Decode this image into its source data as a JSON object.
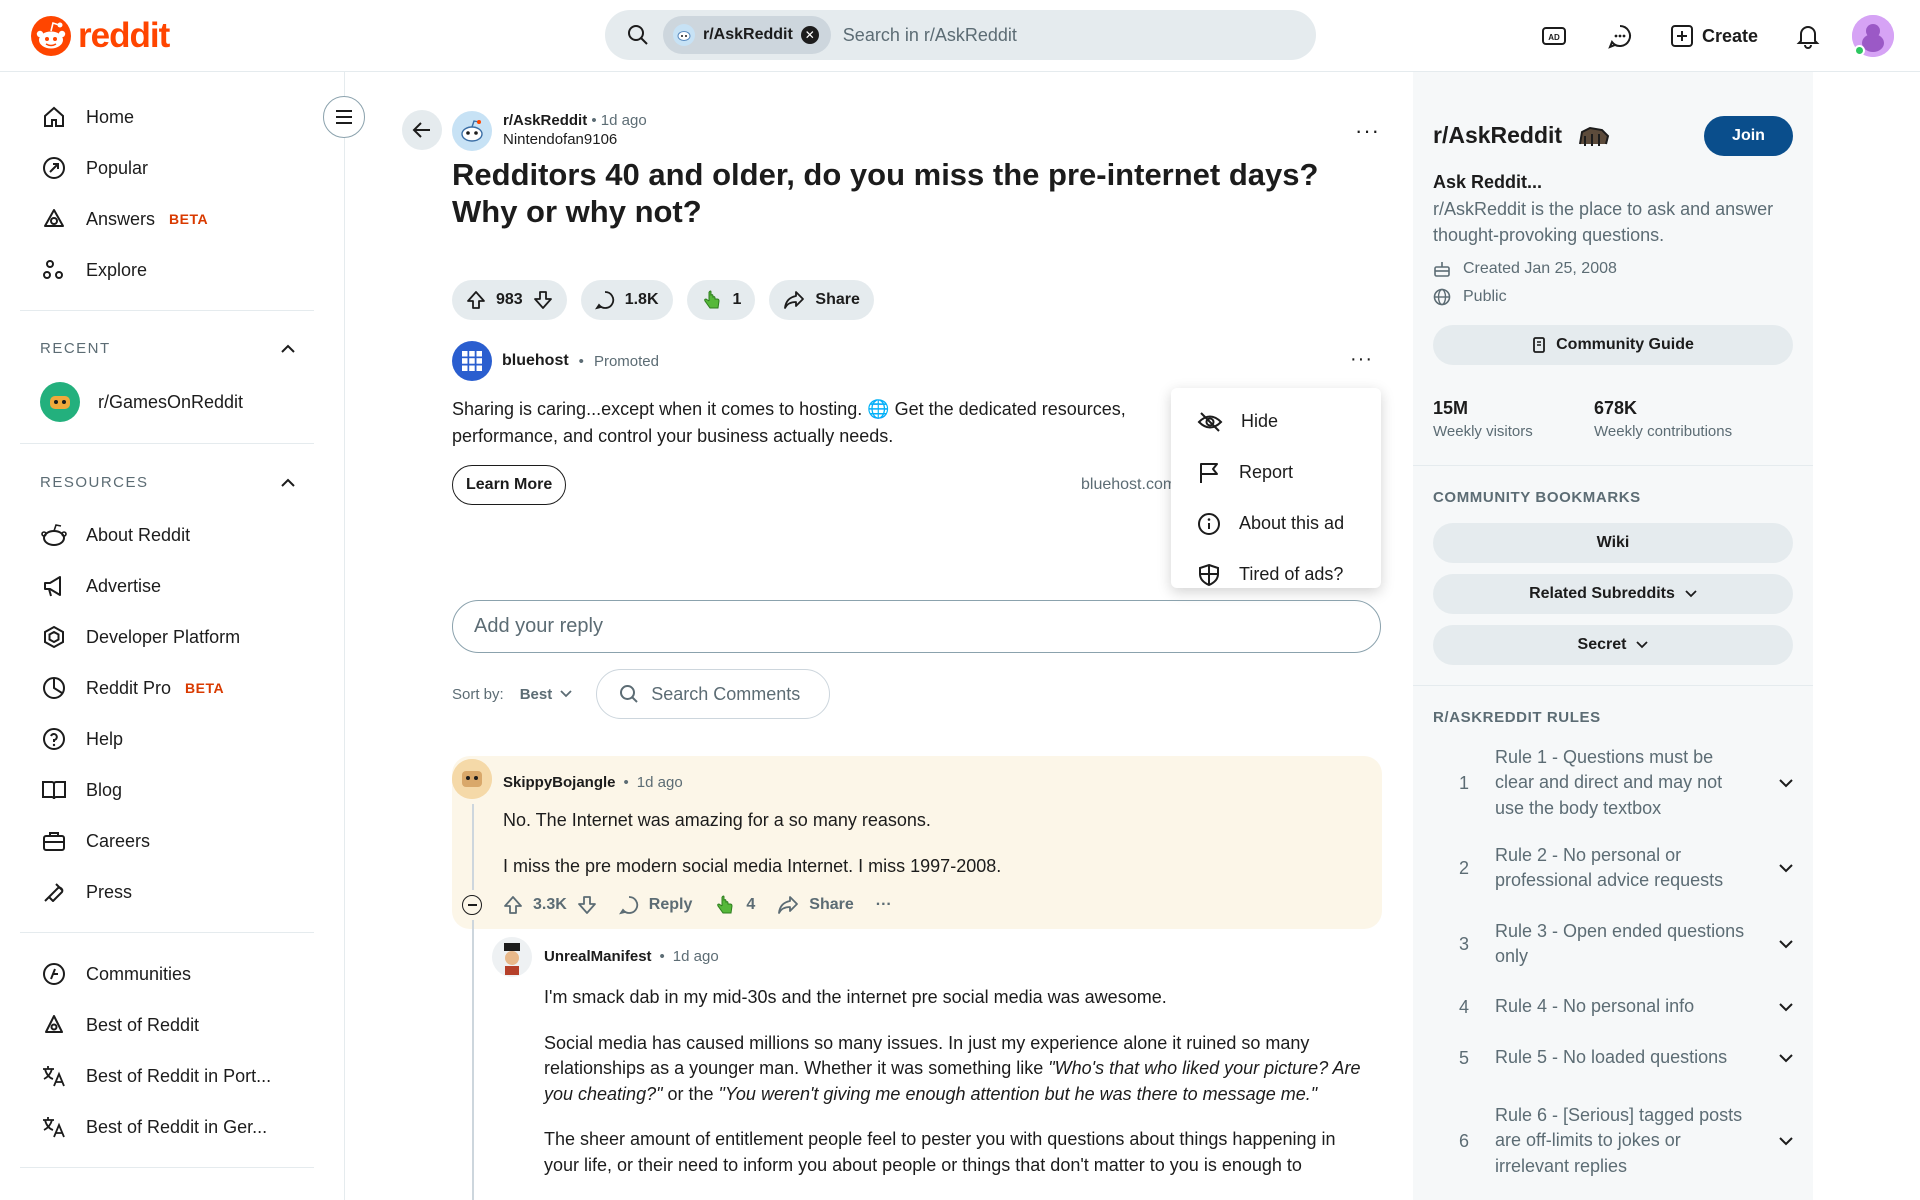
{
  "header": {
    "logo_text": "reddit",
    "search_chip": "r/AskReddit",
    "search_placeholder": "Search in r/AskReddit",
    "create_label": "Create",
    "brand_color": "#ff4500"
  },
  "sidebar": {
    "nav": [
      {
        "label": "Home",
        "icon": "home-icon"
      },
      {
        "label": "Popular",
        "icon": "popular-icon"
      },
      {
        "label": "Answers",
        "icon": "answers-icon",
        "badge": "BETA"
      },
      {
        "label": "Explore",
        "icon": "explore-icon"
      }
    ],
    "recent_title": "RECENT",
    "recent": [
      {
        "label": "r/GamesOnReddit"
      }
    ],
    "resources_title": "RESOURCES",
    "resources": [
      {
        "label": "About Reddit",
        "icon": "reddit-icon"
      },
      {
        "label": "Advertise",
        "icon": "megaphone-icon"
      },
      {
        "label": "Developer Platform",
        "icon": "hexagon-icon"
      },
      {
        "label": "Reddit Pro",
        "icon": "pie-icon",
        "badge": "BETA"
      },
      {
        "label": "Help",
        "icon": "help-icon"
      },
      {
        "label": "Blog",
        "icon": "book-icon"
      },
      {
        "label": "Careers",
        "icon": "briefcase-icon"
      },
      {
        "label": "Press",
        "icon": "press-icon"
      }
    ],
    "more": [
      {
        "label": "Communities",
        "icon": "communities-icon"
      },
      {
        "label": "Best of Reddit",
        "icon": "best-icon"
      },
      {
        "label": "Best of Reddit in Port...",
        "icon": "translate-icon"
      },
      {
        "label": "Best of Reddit in Ger...",
        "icon": "translate-icon"
      }
    ]
  },
  "post": {
    "subreddit": "r/AskReddit",
    "separator": "•",
    "time": "1d ago",
    "author": "Nintendofan9106",
    "title": "Redditors 40 and older, do you miss the pre-internet days? Why or why not?",
    "votes": "983",
    "comments": "1.8K",
    "awards": "1",
    "share_label": "Share",
    "more": "···"
  },
  "ad": {
    "advertiser": "bluehost",
    "separator": "•",
    "promoted": "Promoted",
    "text": "Sharing is caring...except when it comes to hosting. 🌐 Get the dedicated resources, performance, and control your business actually needs.",
    "cta": "Learn More",
    "domain": "bluehost.com",
    "more": "···",
    "menu": [
      {
        "label": "Hide",
        "icon": "hide-icon"
      },
      {
        "label": "Report",
        "icon": "flag-icon"
      },
      {
        "label": "About this ad",
        "icon": "info-icon"
      },
      {
        "label": "Tired of ads?",
        "icon": "shield-icon"
      }
    ]
  },
  "reply": {
    "placeholder": "Add your reply"
  },
  "sort": {
    "label": "Sort by:",
    "value": "Best",
    "search_label": "Search Comments"
  },
  "comments": [
    {
      "author": "SkippyBojangle",
      "separator": "•",
      "time": "1d ago",
      "paragraphs": [
        "No. The Internet was amazing for a so many reasons.",
        "I miss the pre modern social media Internet. I miss 1997-2008."
      ],
      "votes": "3.3K",
      "reply_label": "Reply",
      "awards": "4",
      "share_label": "Share",
      "more": "···"
    },
    {
      "author": "UnrealManifest",
      "separator": "•",
      "time": "1d ago",
      "p1": "I'm smack dab in my mid-30s and the internet pre social media was awesome.",
      "p2_a": "Social media has caused millions so many issues. In just my experience alone it ruined so many relationships as a younger man. Whether it was something like ",
      "p2_q1": "\"Who's that who liked your picture? Are you cheating?\"",
      "p2_b": " or the ",
      "p2_q2": "\"You weren't giving me enough attention but he was there to message me.\"",
      "p3": "The sheer amount of entitlement people feel to pester you with questions about things happening in your life, or their need to inform you about people or things that don't matter to you is enough to"
    }
  ],
  "community": {
    "name": "r/AskReddit",
    "join_label": "Join",
    "tagline": "Ask Reddit...",
    "description": "r/AskReddit is the place to ask and answer thought-provoking questions.",
    "created": "Created Jan 25, 2008",
    "visibility": "Public",
    "guide_label": "Community Guide",
    "stats": [
      {
        "value": "15M",
        "label": "Weekly visitors"
      },
      {
        "value": "678K",
        "label": "Weekly contributions"
      }
    ],
    "bookmarks_title": "COMMUNITY BOOKMARKS",
    "bookmarks": [
      {
        "label": "Wiki"
      },
      {
        "label": "Related Subreddits"
      },
      {
        "label": "Secret"
      }
    ],
    "rules_title": "R/ASKREDDIT RULES",
    "rules": [
      {
        "num": "1",
        "text": "Rule 1 - Questions must be clear and direct and may not use the body textbox"
      },
      {
        "num": "2",
        "text": "Rule 2 - No personal or professional advice requests"
      },
      {
        "num": "3",
        "text": "Rule 3 - Open ended questions only"
      },
      {
        "num": "4",
        "text": "Rule 4 - No personal info"
      },
      {
        "num": "5",
        "text": "Rule 5 - No loaded questions"
      },
      {
        "num": "6",
        "text": "Rule 6 - [Serious] tagged posts are off-limits to jokes or irrelevant replies"
      }
    ],
    "join_color": "#0a4e8c"
  }
}
